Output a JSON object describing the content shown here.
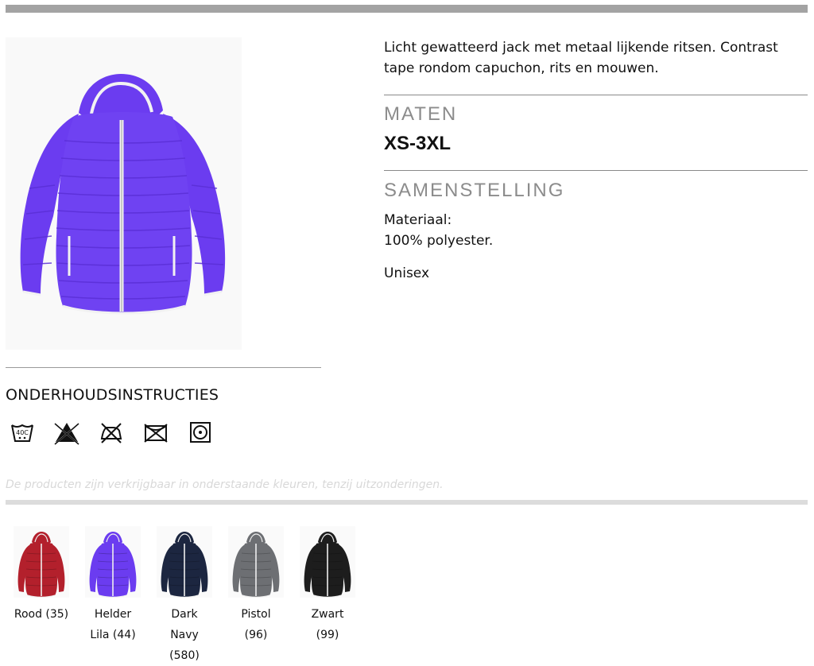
{
  "description": "Licht gewatteerd jack met metaal lijkende ritsen. Contrast tape rondom capuchon, rits en mouwen.",
  "sizes_section": {
    "title": "MATEN",
    "value": "XS-3XL"
  },
  "composition_section": {
    "title": "SAMENSTELLING",
    "material_label": "Materiaal:",
    "material_value": "100% polyester.",
    "fit": "Unisex"
  },
  "care": {
    "title": "ONDERHOUDSINSTRUCTIES",
    "icons": [
      "wash-40c-icon",
      "no-bleach-icon",
      "do-not-iron-icon",
      "do-not-dry-clean-icon",
      "tumble-dry-low-icon"
    ],
    "wash_label": "40C"
  },
  "product": {
    "image": "purple-padded-hooded-jacket",
    "color": "#6b3cf0",
    "trim_color": "#f2f2f2"
  },
  "availability_note": "De producten zijn verkrijgbaar in onderstaande kleuren, tenzij uitzonderingen.",
  "colors": [
    {
      "label": "Rood (35)",
      "hex": "#b3202c"
    },
    {
      "label": "Helder Lila (44)",
      "hex": "#6b3cf0"
    },
    {
      "label": "Dark Navy (580)",
      "hex": "#1c2640"
    },
    {
      "label": "Pistol (96)",
      "hex": "#6d6f73"
    },
    {
      "label": "Zwart (99)",
      "hex": "#1d1d1d"
    }
  ]
}
